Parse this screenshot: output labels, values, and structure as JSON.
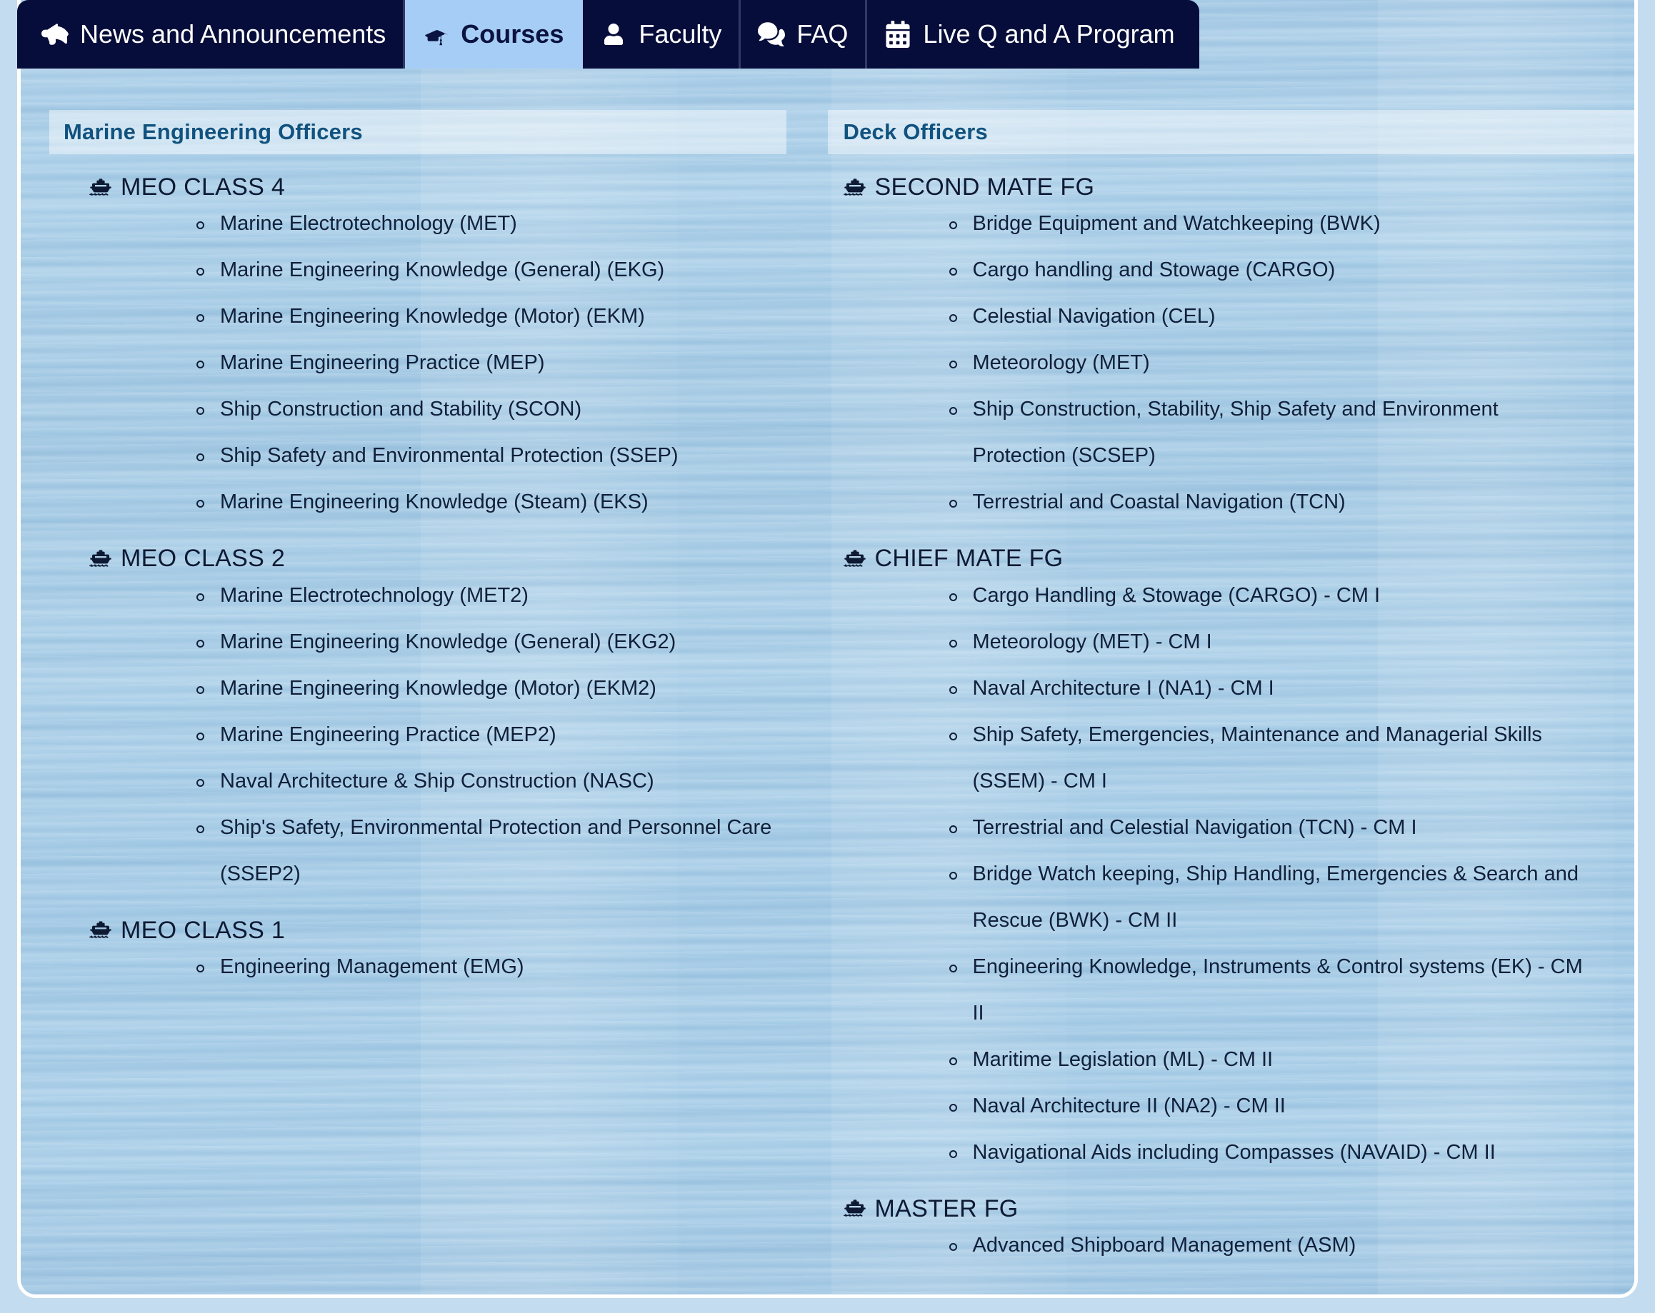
{
  "theme": {
    "tabbar_bg": "#060d3a",
    "active_tab_bg": "#a6cdf5",
    "active_tab_fg": "#0b1340",
    "panel_title_color": "#11527f",
    "body_text_color": "#11203a",
    "page_bg": "#c3dcef"
  },
  "tabs": [
    {
      "label": "News and Announcements",
      "icon": "megaphone-icon",
      "active": false
    },
    {
      "label": "Courses",
      "icon": "graduation-cap-icon",
      "active": true
    },
    {
      "label": "Faculty",
      "icon": "user-icon",
      "active": false
    },
    {
      "label": "FAQ",
      "icon": "comments-icon",
      "active": false
    },
    {
      "label": "Live Q and A Program",
      "icon": "calendar-icon",
      "active": false
    }
  ],
  "columns": [
    {
      "panel_title": "Marine Engineering Officers",
      "sections": [
        {
          "heading": "MEO CLASS 4",
          "icon": "ship-icon",
          "courses": [
            "Marine Electrotechnology (MET)",
            "Marine Engineering Knowledge (General) (EKG)",
            "Marine Engineering Knowledge (Motor) (EKM)",
            "Marine Engineering Practice (MEP)",
            "Ship Construction and Stability (SCON)",
            "Ship Safety and Environmental Protection (SSEP)",
            "Marine Engineering Knowledge (Steam) (EKS)"
          ]
        },
        {
          "heading": "MEO CLASS 2",
          "icon": "ship-icon",
          "courses": [
            "Marine Electrotechnology (MET2)",
            "Marine Engineering Knowledge (General) (EKG2)",
            "Marine Engineering Knowledge (Motor) (EKM2)",
            "Marine Engineering Practice (MEP2)",
            "Naval Architecture & Ship Construction (NASC)",
            "Ship's Safety, Environmental Protection and Personnel Care (SSEP2)"
          ]
        },
        {
          "heading": "MEO CLASS 1",
          "icon": "ship-icon",
          "courses": [
            "Engineering Management (EMG)"
          ]
        }
      ]
    },
    {
      "panel_title": "Deck Officers",
      "sections": [
        {
          "heading": "SECOND MATE FG",
          "icon": "ship-icon",
          "courses": [
            "Bridge Equipment and Watchkeeping (BWK)",
            "Cargo handling and Stowage (CARGO)",
            "Celestial Navigation (CEL)",
            "Meteorology (MET)",
            "Ship Construction, Stability, Ship Safety and Environment Protection (SCSEP)",
            "Terrestrial and Coastal Navigation (TCN)"
          ]
        },
        {
          "heading": "CHIEF MATE FG",
          "icon": "ship-icon",
          "courses": [
            "Cargo Handling & Stowage (CARGO) - CM I",
            "Meteorology (MET) - CM I",
            "Naval Architecture I (NA1) - CM I",
            "Ship Safety, Emergencies, Maintenance and Managerial Skills (SSEM) - CM I",
            "Terrestrial and Celestial Navigation (TCN) - CM I",
            "Bridge Watch keeping, Ship Handling, Emergencies & Search and Rescue (BWK) - CM II",
            "Engineering Knowledge, Instruments & Control systems (EK) - CM II",
            "Maritime Legislation (ML) - CM II",
            "Naval Architecture II (NA2) - CM II",
            "Navigational Aids including Compasses (NAVAID) - CM II"
          ]
        },
        {
          "heading": "MASTER FG",
          "icon": "ship-icon",
          "courses": [
            "Advanced Shipboard Management (ASM)"
          ]
        }
      ]
    }
  ]
}
